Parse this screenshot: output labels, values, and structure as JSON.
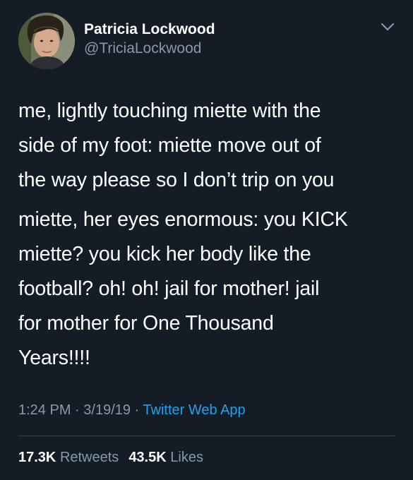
{
  "author": {
    "display_name": "Patricia Lockwood",
    "handle": "@TriciaLockwood"
  },
  "tweet": {
    "paragraphs": [
      "me, lightly touching miette with the\nside of my foot: miette move out of\nthe way please so I don’t trip on you",
      "miette, her eyes enormous: you KICK\nmiette? you kick her body like the\nfootball? oh! oh! jail for mother! jail\nfor mother for One Thousand\nYears!!!!"
    ],
    "time": "1:24 PM",
    "date": "3/19/19",
    "separator": " · ",
    "source": "Twitter Web App"
  },
  "stats": {
    "retweets_count": "17.3K",
    "retweets_label": "Retweets",
    "likes_count": "43.5K",
    "likes_label": "Likes"
  },
  "colors": {
    "background": "#141d26",
    "text_primary": "#ffffff",
    "text_secondary": "#8899a6",
    "link": "#1da1f2",
    "divider": "#38444d"
  },
  "icons": {
    "avatar": "profile-photo",
    "menu": "chevron-down-icon"
  }
}
